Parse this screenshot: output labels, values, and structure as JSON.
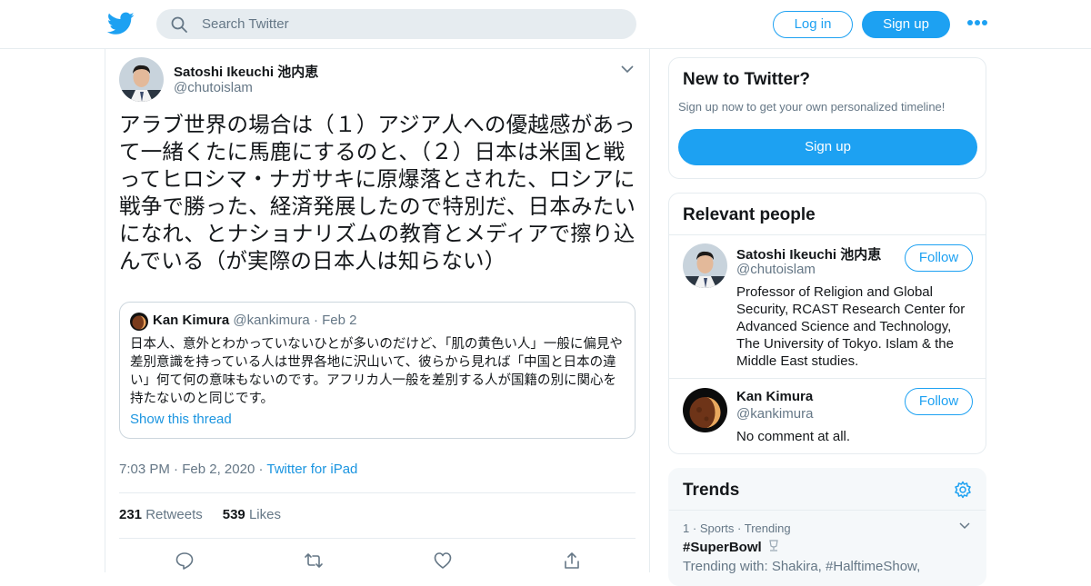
{
  "header": {
    "search_placeholder": "Search Twitter",
    "login_label": "Log in",
    "signup_label": "Sign up",
    "brand_color": "#1da1f2"
  },
  "tweet": {
    "author_name": "Satoshi Ikeuchi 池内恵",
    "author_handle": "@chutoislam",
    "text": "アラブ世界の場合は（１）アジア人への優越感があって一緒くたに馬鹿にするのと、（２）日本は米国と戦ってヒロシマ・ナガサキに原爆落とされた、ロシアに戦争で勝った、経済発展したので特別だ、日本みたいになれ、とナショナリズムの教育とメディアで擦り込んでいる（が実際の日本人は知らない）",
    "quote": {
      "name": "Kan Kimura",
      "handle": "@kankimura",
      "dot": "·",
      "date": "Feb 2",
      "text": "日本人、意外とわかっていないひとが多いのだけど、「肌の黄色い人」一般に偏見や差別意識を持っている人は世界各地に沢山いて、彼らから見れば「中国と日本の違い」何て何の意味もないのです。アフリカ人一般を差別する人が国籍の別に関心を持たないのと同じです。",
      "show_thread": "Show this thread"
    },
    "time": "7:03 PM",
    "date": "Feb 2, 2020",
    "dot": "·",
    "source": "Twitter for iPad",
    "retweets_count": "231",
    "retweets_label": "Retweets",
    "likes_count": "539",
    "likes_label": "Likes"
  },
  "new_to_twitter": {
    "title": "New to Twitter?",
    "subtitle": "Sign up now to get your own personalized timeline!",
    "signup_label": "Sign up"
  },
  "relevant_people": {
    "title": "Relevant people",
    "people": [
      {
        "name": "Satoshi Ikeuchi 池内恵",
        "handle": "@chutoislam",
        "bio": "Professor of Religion and Global Security, RCAST Research Center for Advanced Science and Technology, The University of Tokyo. Islam & the Middle East studies.",
        "follow_label": "Follow"
      },
      {
        "name": "Kan Kimura",
        "handle": "@kankimura",
        "bio": "No comment at all.",
        "follow_label": "Follow"
      }
    ]
  },
  "trends": {
    "title": "Trends",
    "items": [
      {
        "rank": "1",
        "dot1": "·",
        "category": "Sports",
        "dot2": "·",
        "status": "Trending",
        "tag": "#SuperBowl",
        "trending_with": "Trending with: Shakira, #HalftimeShow,"
      }
    ]
  }
}
